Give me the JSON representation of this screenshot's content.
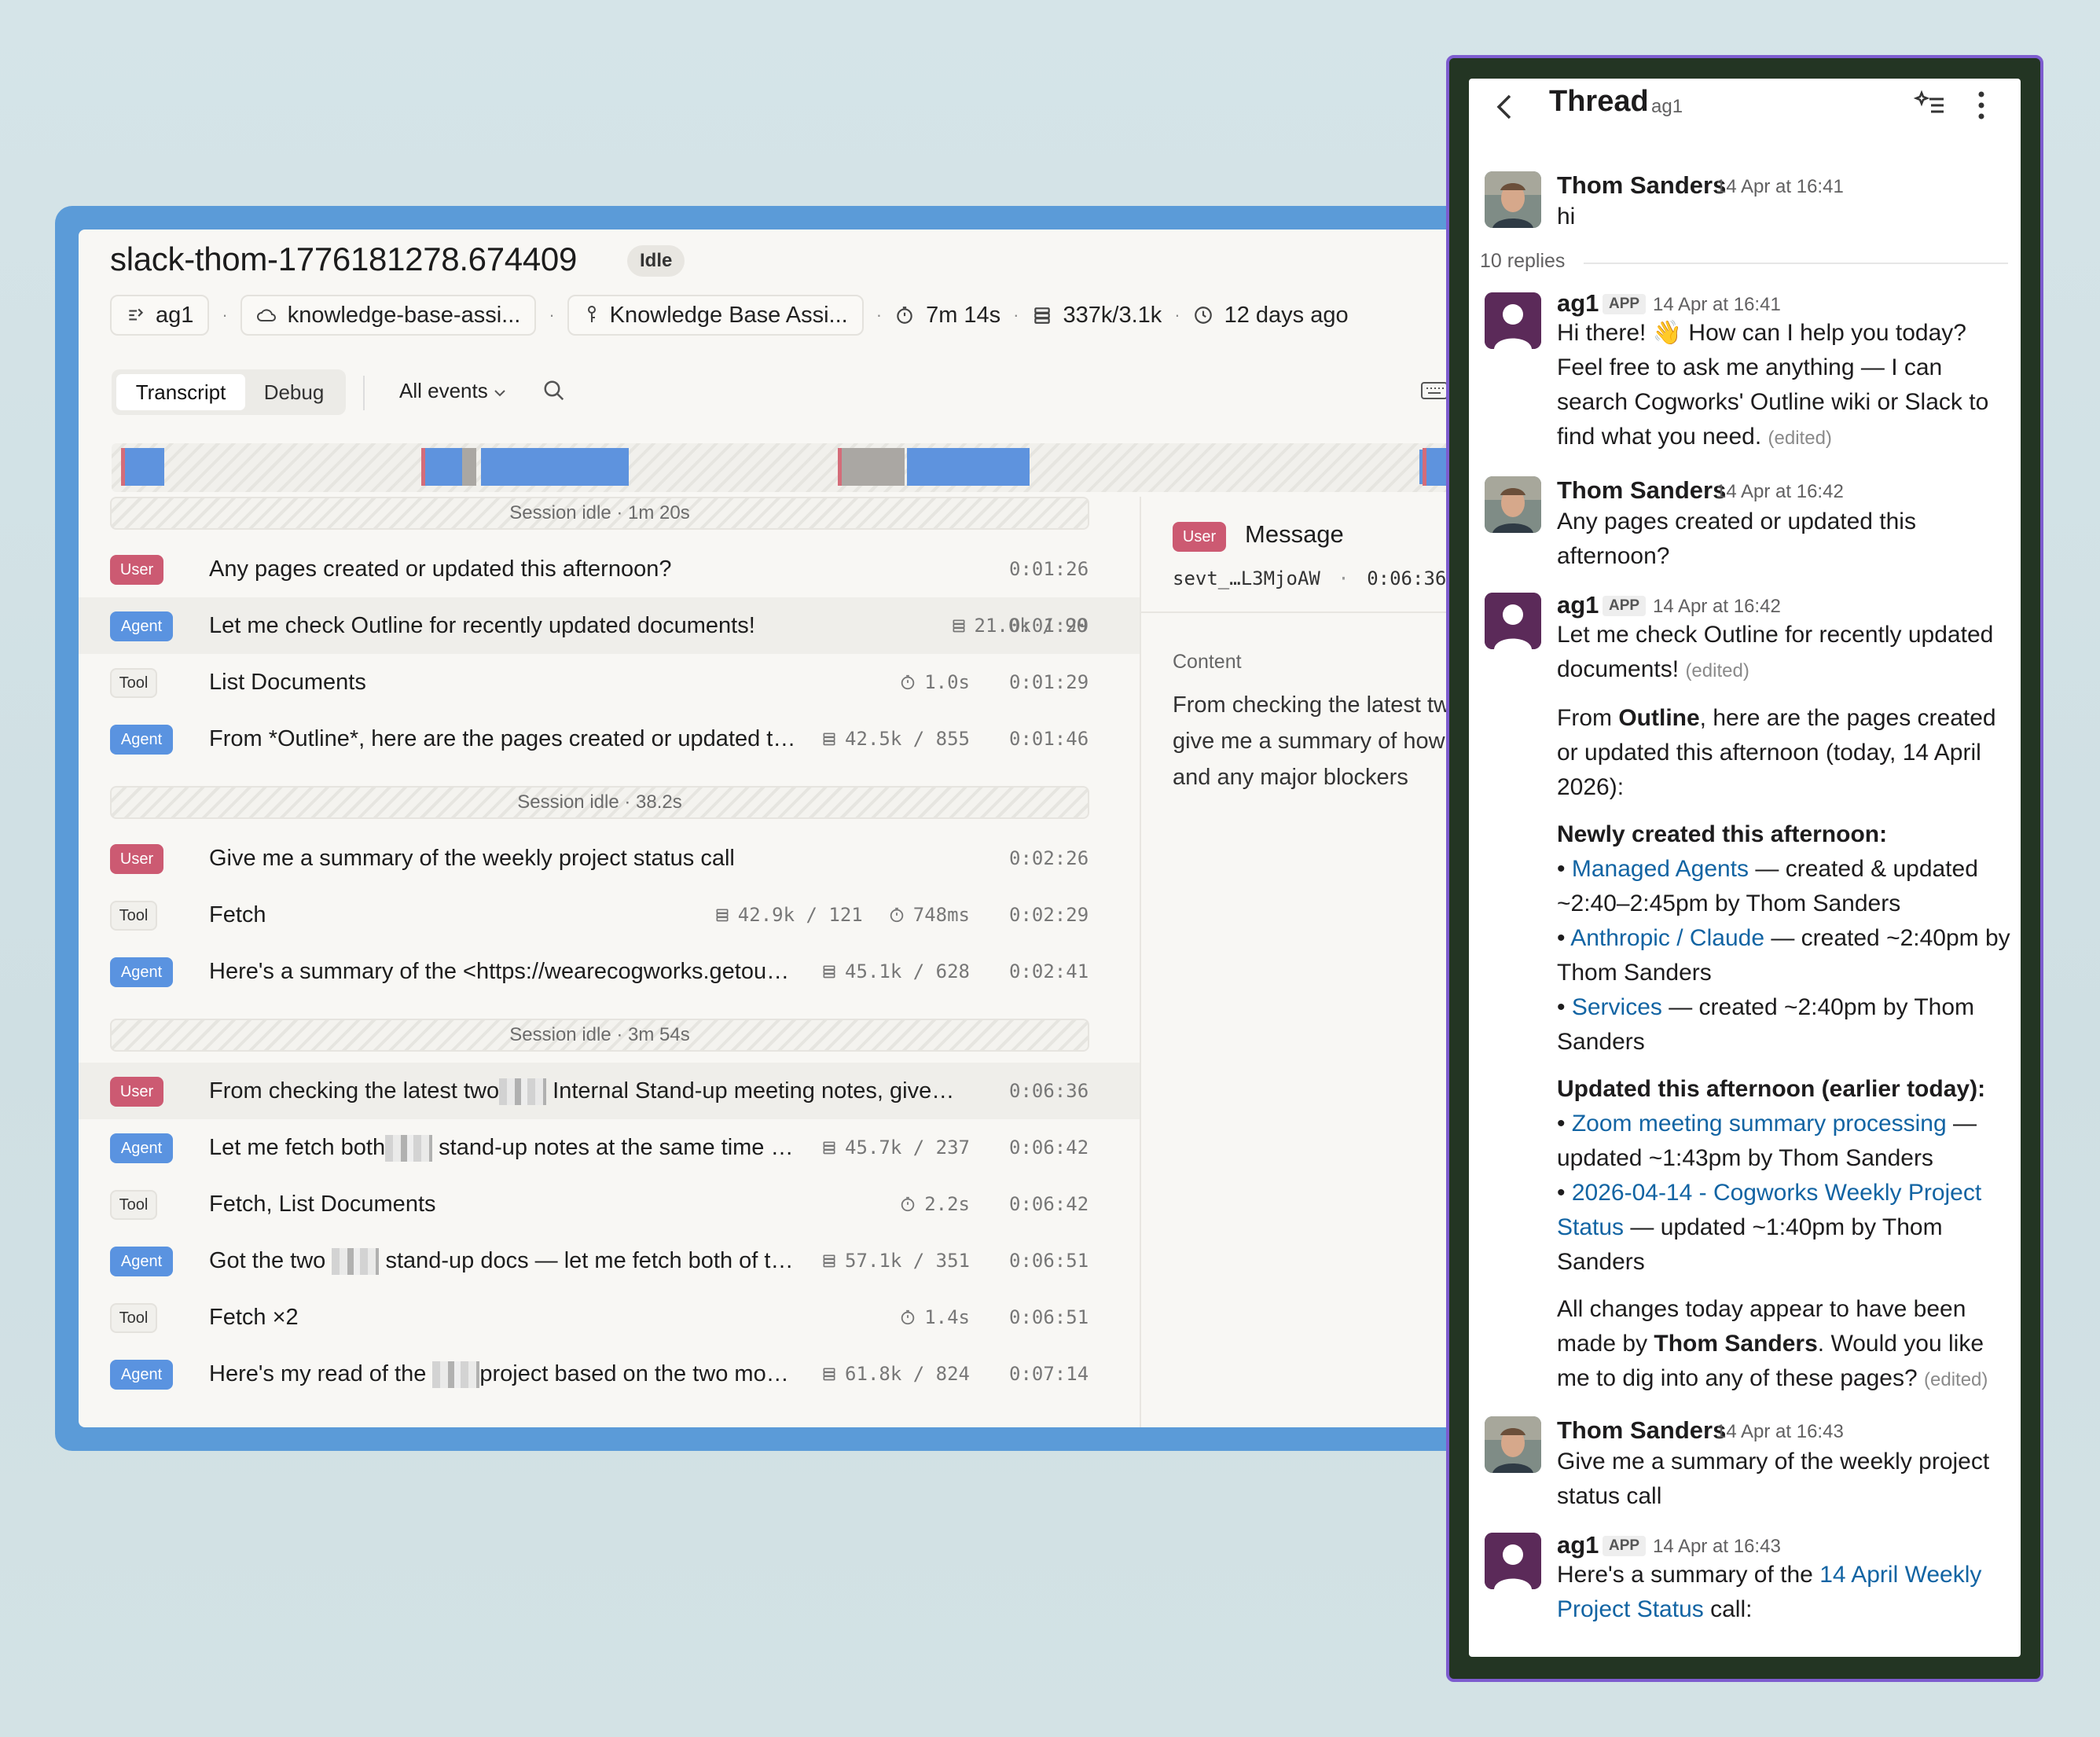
{
  "console": {
    "title": "slack-thom-1776181278.674409",
    "status": "Idle",
    "meta": {
      "agent": "ag1",
      "environment": "knowledge-base-assi...",
      "assistant": "Knowledge Base Assi...",
      "duration": "7m 14s",
      "tokens": "337k/3.1k",
      "age": "12 days ago"
    },
    "tabs": [
      "Transcript",
      "Debug"
    ],
    "filter": "All events",
    "idle_labels": [
      "Session idle · 1m 20s",
      "Session idle · 38.2s",
      "Session idle · 3m 54s"
    ],
    "rows": [
      {
        "tag": "User",
        "text": "Any pages created or updated this afternoon?",
        "metric": "",
        "time": "0:01:26"
      },
      {
        "tag": "Agent",
        "text": "Let me check Outline for recently updated documents!",
        "metric": "21.0k / 90",
        "time": "0:01:29"
      },
      {
        "tag": "Tool",
        "text": "List Documents",
        "metric": "1.0s",
        "time": "0:01:29"
      },
      {
        "tag": "Agent",
        "text": "From *Outline*, here are the pages created or updated t…",
        "metric": "42.5k / 855",
        "time": "0:01:46"
      },
      {
        "tag": "User",
        "text": "Give me a summary of the weekly project status call",
        "metric": "",
        "time": "0:02:26"
      },
      {
        "tag": "Tool",
        "text": "Fetch",
        "metric": "42.9k / 121",
        "metric2": "748ms",
        "time": "0:02:29"
      },
      {
        "tag": "Agent",
        "text": "Here's a summary of the <https://wearecogworks.getou…",
        "metric": "45.1k / 628",
        "time": "0:02:41"
      },
      {
        "tag": "User",
        "text_a": "From checking the latest two",
        "text_b": "Internal Stand-up meeting notes, give…",
        "metric": "",
        "time": "0:06:36"
      },
      {
        "tag": "Agent",
        "text_a": "Let me fetch both",
        "text_b": "stand-up notes at the same time …",
        "metric": "45.7k / 237",
        "time": "0:06:42"
      },
      {
        "tag": "Tool",
        "text": "Fetch, List Documents",
        "metric": "2.2s",
        "time": "0:06:42"
      },
      {
        "tag": "Agent",
        "text_a": "Got the two",
        "text_b": "stand-up docs — let me fetch both of t…",
        "metric": "57.1k / 351",
        "time": "0:06:51"
      },
      {
        "tag": "Tool",
        "text": "Fetch ×2",
        "metric": "1.4s",
        "time": "0:06:51"
      },
      {
        "tag": "Agent",
        "text_a": "Here's my read of the",
        "text_b": "project based on the two mo…",
        "metric": "61.8k / 824",
        "time": "0:07:14"
      }
    ],
    "detail": {
      "tag": "User",
      "title": "Message",
      "event_id": "sevt_…L3MjoAW",
      "time": "0:06:36",
      "content_label": "Content",
      "content": "From checking the latest two meeting notes, give me a summary of how the project is going and any major blockers"
    }
  },
  "thread": {
    "title": "Thread",
    "channel": "ag1",
    "replies_label": "10 replies",
    "app_badge": "APP",
    "edited_label": "(edited)",
    "messages": [
      {
        "author": "Thom Sanders",
        "time": "14 Apr at 16:41",
        "text": "hi"
      },
      {
        "author": "ag1",
        "time": "14 Apr at 16:41",
        "text": "Hi there! 👋 How can I help you today? Feel free to ask me anything — I can search Cogworks' Outline wiki or Slack to find what you need."
      },
      {
        "author": "Thom Sanders",
        "time": "14 Apr at 16:42",
        "text": "Any pages created or updated this afternoon?"
      },
      {
        "author": "ag1",
        "time": "14 Apr at 16:42",
        "text": "Let me check Outline for recently updated documents!",
        "p1_a": "From ",
        "p1_b": "Outline",
        "p1_c": ", here are the pages created or updated this afternoon (today, 14 April 2026):",
        "h1": "Newly created this afternoon:",
        "new_items": [
          {
            "link": "Managed Agents",
            "rest": " — created & updated ~2:40–2:45pm by Thom Sanders"
          },
          {
            "link": "Anthropic / Claude",
            "rest": " — created ~2:40pm by Thom Sanders"
          },
          {
            "link": "Services",
            "rest": " — created ~2:40pm by Thom Sanders"
          }
        ],
        "h2": "Updated this afternoon (earlier today):",
        "upd_items": [
          {
            "link": "Zoom meeting summary processing",
            "rest": " — updated ~1:43pm by Thom Sanders"
          },
          {
            "link": "2026-04-14 - Cogworks Weekly Project Status",
            "rest": " — updated ~1:40pm by Thom Sanders"
          }
        ],
        "p2_a": "All changes today appear to have been made by ",
        "p2_b": "Thom Sanders",
        "p2_c": ". Would you like me to dig into any of these pages?"
      },
      {
        "author": "Thom Sanders",
        "time": "14 Apr at 16:43",
        "text": "Give me a summary of the weekly project status call"
      },
      {
        "author": "ag1",
        "time": "14 Apr at 16:43",
        "text_a": "Here's a summary of the ",
        "link": "14 April Weekly Project Status",
        "text_b": " call:"
      }
    ]
  }
}
